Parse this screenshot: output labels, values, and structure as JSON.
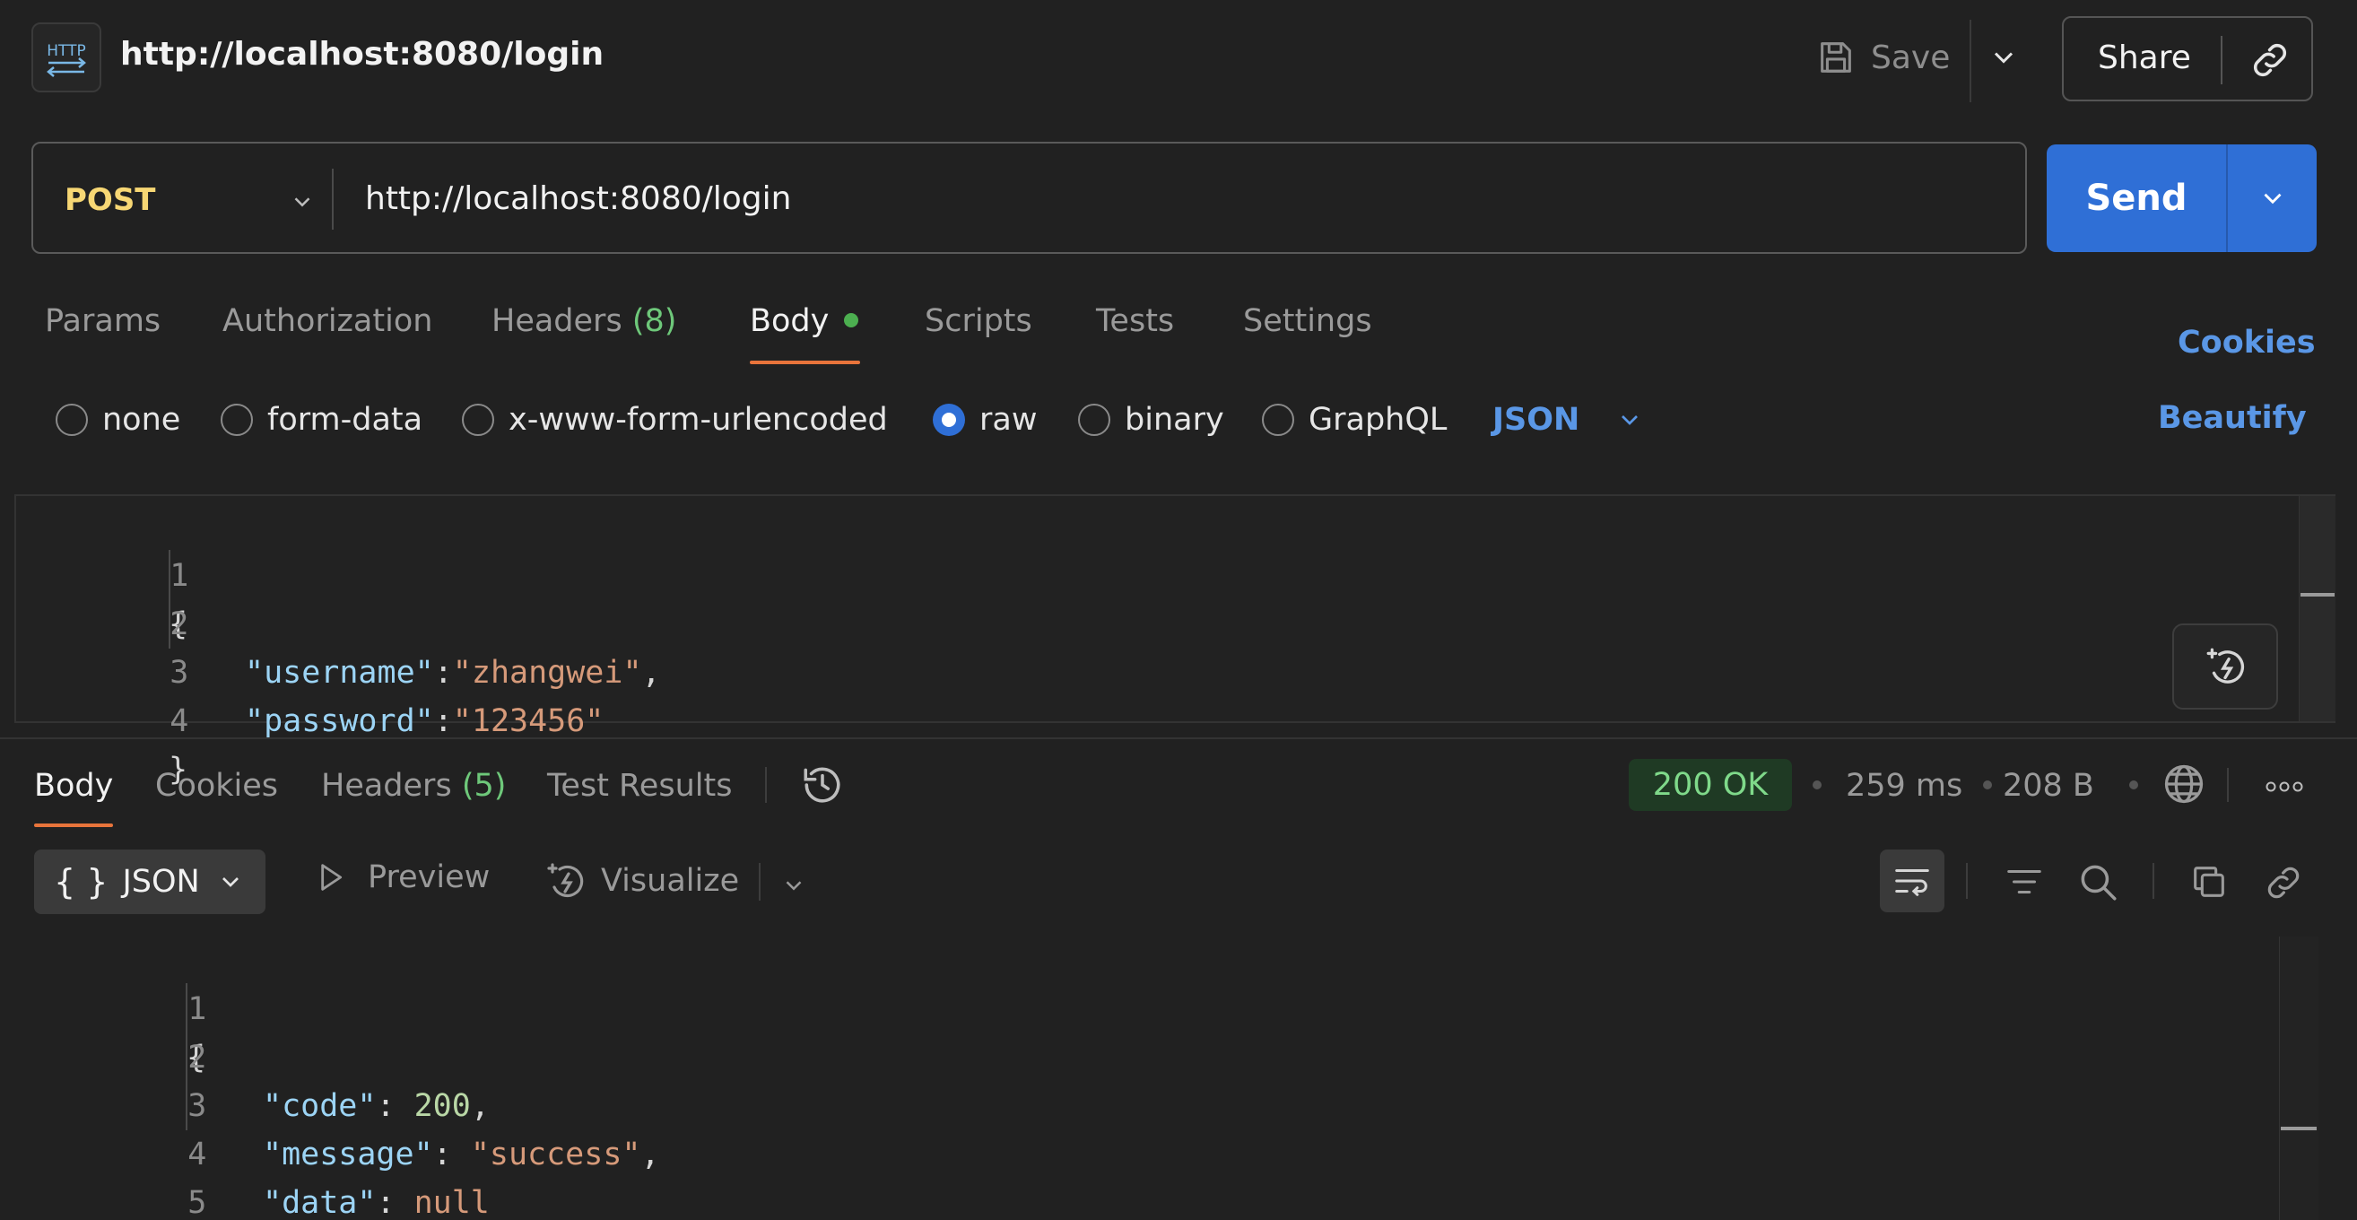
{
  "header": {
    "icon_text": "HTTP",
    "title": "http://localhost:8080/login",
    "save_label": "Save",
    "share_label": "Share"
  },
  "request": {
    "method": "POST",
    "url": "http://localhost:8080/login",
    "send_label": "Send"
  },
  "request_tabs": {
    "params": "Params",
    "authorization": "Authorization",
    "headers": "Headers",
    "headers_count": "(8)",
    "body": "Body",
    "scripts": "Scripts",
    "tests": "Tests",
    "settings": "Settings",
    "cookies": "Cookies"
  },
  "body_types": {
    "none": "none",
    "form_data": "form-data",
    "urlencoded": "x-www-form-urlencoded",
    "raw": "raw",
    "binary": "binary",
    "graphql": "GraphQL",
    "format": "JSON",
    "beautify": "Beautify",
    "selected": "raw"
  },
  "request_body": {
    "line_numbers": [
      "1",
      "2",
      "3",
      "4"
    ],
    "open_brace": "{",
    "close_brace": "}",
    "fields": [
      {
        "key": "\"username\"",
        "colon": ":",
        "value": "\"zhangwei\"",
        "comma": ","
      },
      {
        "key": "\"password\"",
        "colon": ":",
        "value": "\"123456\"",
        "comma": ""
      }
    ]
  },
  "response_tabs": {
    "body": "Body",
    "cookies": "Cookies",
    "headers": "Headers",
    "headers_count": "(5)",
    "test_results": "Test Results"
  },
  "response_meta": {
    "status": "200 OK",
    "time": "259 ms",
    "size": "208 B",
    "status_color": "#7fd98a"
  },
  "response_toolbar": {
    "format_braces": "{ }",
    "format": "JSON",
    "preview": "Preview",
    "visualize": "Visualize"
  },
  "response_body": {
    "line_numbers": [
      "1",
      "2",
      "3",
      "4",
      "5"
    ],
    "open_brace": "{",
    "close_brace": "}",
    "fields": [
      {
        "key": "\"code\"",
        "colon": ": ",
        "value": "200",
        "comma": ","
      },
      {
        "key": "\"message\"",
        "colon": ": ",
        "value": "\"success\"",
        "comma": ","
      },
      {
        "key": "\"data\"",
        "colon": ": ",
        "value": "null",
        "comma": ""
      }
    ]
  },
  "colors": {
    "accent_blue": "#2f6fd6",
    "tab_underline": "#e8743b",
    "method": "#f7d774"
  }
}
